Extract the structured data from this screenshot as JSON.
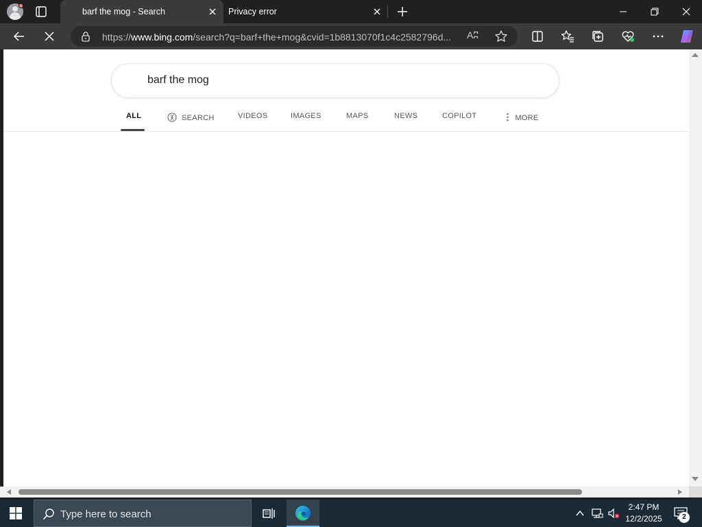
{
  "browser": {
    "tabs": [
      {
        "title": "barf the mog - Search",
        "active": true
      },
      {
        "title": "Privacy error",
        "active": false
      }
    ],
    "url": {
      "prefix": "https://",
      "domain": "www.bing.com",
      "rest": "/search?q=barf+the+mog&cvid=1b8813070f1c4c2582796d..."
    },
    "read_aloud_glyph": "Aʭ",
    "colors": {
      "titlebar": "#202020",
      "toolbar": "#3b3b3b",
      "address_bg": "#2b2b2b"
    }
  },
  "page": {
    "search_query": "barf the mog",
    "scopes": [
      {
        "label": "ALL",
        "active": true
      },
      {
        "label": "SEARCH",
        "active": false
      },
      {
        "label": "VIDEOS",
        "active": false
      },
      {
        "label": "IMAGES",
        "active": false
      },
      {
        "label": "MAPS",
        "active": false
      },
      {
        "label": "NEWS",
        "active": false
      },
      {
        "label": "COPILOT",
        "active": false
      },
      {
        "label": "MORE",
        "active": false
      }
    ],
    "more_glyph": "⋮"
  },
  "taskbar": {
    "search_placeholder": "Type here to search",
    "time": "2:47 PM",
    "date": "12/2/2025",
    "notification_count": "2",
    "icons": [
      "windows-start-icon",
      "search-icon",
      "task-view-icon",
      "edge-icon",
      "chevron-up-icon",
      "network-icon",
      "volume-muted-icon",
      "notification-icon"
    ]
  }
}
